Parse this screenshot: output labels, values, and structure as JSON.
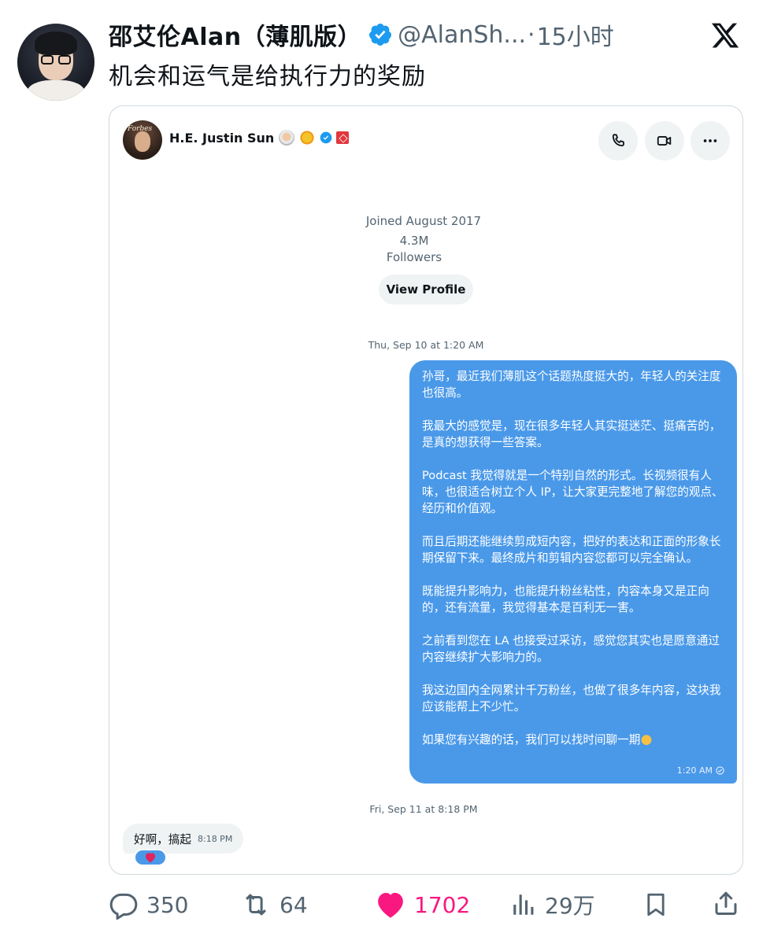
{
  "tweet": {
    "author_name": "邵艾伦Alan（薄肌版）",
    "handle": "@AlanSh...",
    "separator": "·",
    "time": "15小时",
    "text": "机会和运气是给执行力的奖励"
  },
  "dm": {
    "contact_name": "H.E. Justin Sun",
    "avatar_mark": "Forbes",
    "joined": "Joined August 2017",
    "follower_count": "4.3M",
    "followers_label": "Followers",
    "view_profile_label": "View Profile",
    "date_1": "Thu, Sep 10 at 1:20 AM",
    "outgoing_paragraphs": [
      "孙哥，最近我们薄肌这个话题热度挺大的，年轻人的关注度也很高。",
      "我最大的感觉是，现在很多年轻人其实挺迷茫、挺痛苦的，是真的想获得一些答案。",
      "Podcast 我觉得就是一个特别自然的形式。长视频很有人味，也很适合树立个人 IP，让大家更完整地了解您的观点、经历和价值观。",
      "而且后期还能继续剪成短内容，把好的表达和正面的形象长期保留下来。最终成片和剪辑内容您都可以完全确认。",
      "既能提升影响力，也能提升粉丝粘性，内容本身又是正向的，还有流量，我觉得基本是百利无一害。",
      "之前看到您在 LA 也接受过采访，感觉您其实也是愿意通过内容继续扩大影响力的。",
      "我这边国内全网累计千万粉丝，也做了很多年内容，这块我应该能帮上不少忙。",
      "如果您有兴趣的话，我们可以找时间聊一期"
    ],
    "outgoing_time": "1:20 AM",
    "date_2": "Fri, Sep 11 at 8:18 PM",
    "incoming_text": "好啊，搞起",
    "incoming_time": "8:18 PM"
  },
  "actions": {
    "replies": "350",
    "retweets": "64",
    "likes": "1702",
    "views": "29万"
  },
  "colors": {
    "bubble_blue": "#4a99e9",
    "like_pink": "#f91880",
    "verified_blue": "#1d9bf0",
    "muted_text": "#536471"
  }
}
